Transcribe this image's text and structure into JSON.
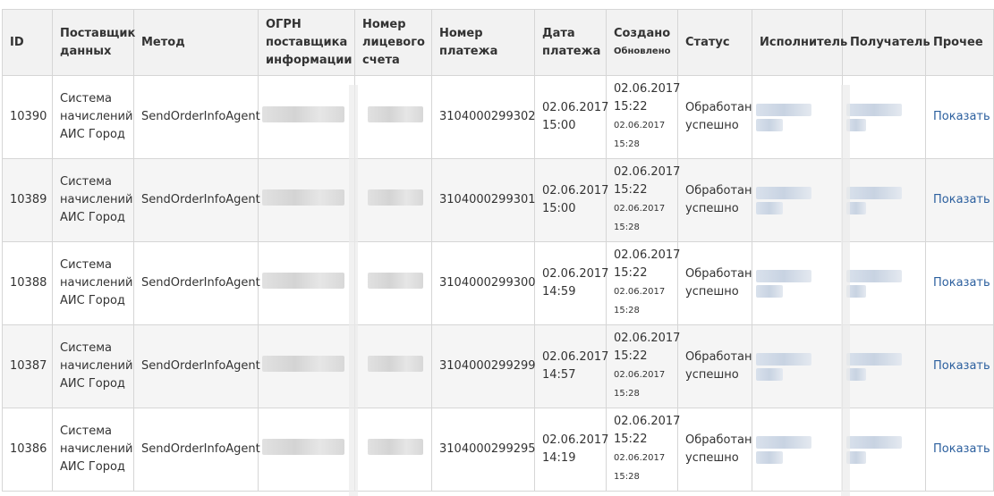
{
  "columns": {
    "id": "ID",
    "provider": "Поставщик данных",
    "method": "Метод",
    "ogrn": "ОГРН поставщика информации",
    "account": "Номер лицевого счета",
    "payment_no": "Номер платежа",
    "payment_date": "Дата платежа",
    "created": "Создано",
    "updated": "Обновлено",
    "status": "Статус",
    "executor": "Исполнитель",
    "recipient": "Получатель",
    "other": "Прочее"
  },
  "rows": [
    {
      "id": "10390",
      "provider": "Система начислений АИС Город",
      "method": "SendOrderInfoAgent",
      "payment_no": "3104000299302",
      "payment_date": "02.06.2017 15:00",
      "created": "02.06.2017 15:22",
      "updated": "02.06.2017 15:28",
      "status": "Обработан успешно",
      "action": "Показать"
    },
    {
      "id": "10389",
      "provider": "Система начислений АИС Город",
      "method": "SendOrderInfoAgent",
      "payment_no": "3104000299301",
      "payment_date": "02.06.2017 15:00",
      "created": "02.06.2017 15:22",
      "updated": "02.06.2017 15:28",
      "status": "Обработан успешно",
      "action": "Показать"
    },
    {
      "id": "10388",
      "provider": "Система начислений АИС Город",
      "method": "SendOrderInfoAgent",
      "payment_no": "3104000299300",
      "payment_date": "02.06.2017 14:59",
      "created": "02.06.2017 15:22",
      "updated": "02.06.2017 15:28",
      "status": "Обработан успешно",
      "action": "Показать"
    },
    {
      "id": "10387",
      "provider": "Система начислений АИС Город",
      "method": "SendOrderInfoAgent",
      "payment_no": "3104000299299",
      "payment_date": "02.06.2017 14:57",
      "created": "02.06.2017 15:22",
      "updated": "02.06.2017 15:28",
      "status": "Обработан успешно",
      "action": "Показать"
    },
    {
      "id": "10386",
      "provider": "Система начислений АИС Город",
      "method": "SendOrderInfoAgent",
      "payment_no": "3104000299295",
      "payment_date": "02.06.2017 14:19",
      "created": "02.06.2017 15:22",
      "updated": "02.06.2017 15:28",
      "status": "Обработан успешно",
      "action": "Показать"
    }
  ],
  "colors": {
    "link": "#2b5f9e",
    "header_bg": "#f2f2f2",
    "border": "#d6d6d6",
    "row_alt": "#f5f5f5"
  }
}
